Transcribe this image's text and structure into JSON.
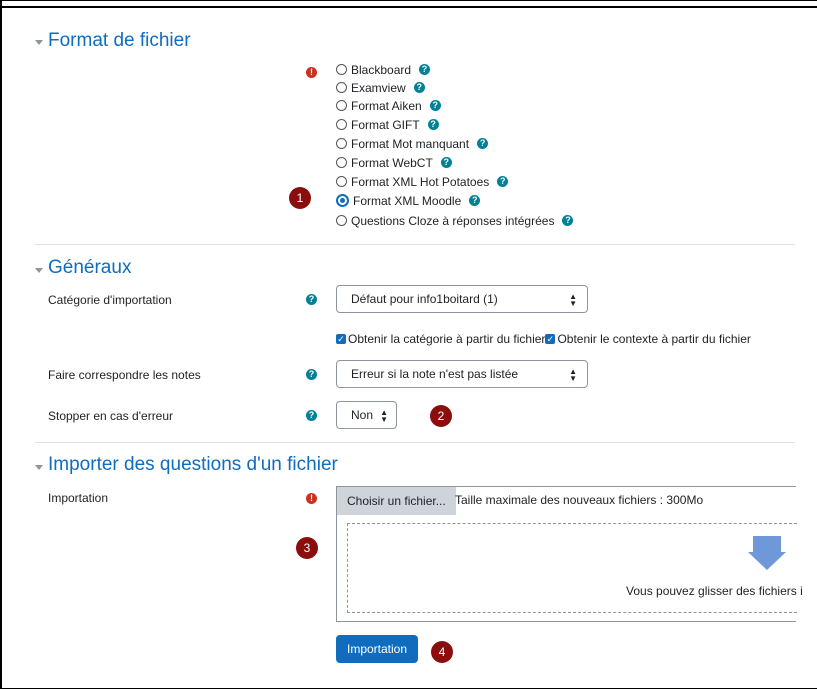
{
  "sections": {
    "format": {
      "title": "Format de fichier",
      "options": [
        {
          "label": "Blackboard",
          "checked": false
        },
        {
          "label": "Examview",
          "checked": false
        },
        {
          "label": "Format Aiken",
          "checked": false
        },
        {
          "label": "Format GIFT",
          "checked": false
        },
        {
          "label": "Format Mot manquant",
          "checked": false
        },
        {
          "label": "Format WebCT",
          "checked": false
        },
        {
          "label": "Format XML Hot Potatoes",
          "checked": false
        },
        {
          "label": "Format XML Moodle",
          "checked": true
        },
        {
          "label": "Questions Cloze à réponses intégrées",
          "checked": false
        }
      ]
    },
    "general": {
      "title": "Généraux",
      "category_label": "Catégorie d'importation",
      "category_value": "Défaut pour info1boitard (1)",
      "chk_category": "Obtenir la catégorie à partir du fichier",
      "chk_context": "Obtenir le contexte à partir du fichier",
      "grades_label": "Faire correspondre les notes",
      "grades_value": "Erreur si la note n'est pas listée",
      "stop_label": "Stopper en cas d'erreur",
      "stop_value": "Non"
    },
    "import": {
      "title": "Importer des questions d'un fichier",
      "label": "Importation",
      "choose_button": "Choisir un fichier...",
      "max_size": "Taille maximale des nouveaux fichiers : 300Mo",
      "drop_text": "Vous pouvez glisser des fichiers i",
      "submit": "Importation"
    }
  },
  "badges": [
    "1",
    "2",
    "3",
    "4"
  ],
  "icons": {
    "help": "?",
    "required": "!",
    "select_arrow": "▲▼"
  },
  "colors": {
    "link_blue": "#0f6cbf",
    "help_teal": "#008196",
    "required_red": "#ca3120",
    "badge_red": "#8b0e0e"
  }
}
